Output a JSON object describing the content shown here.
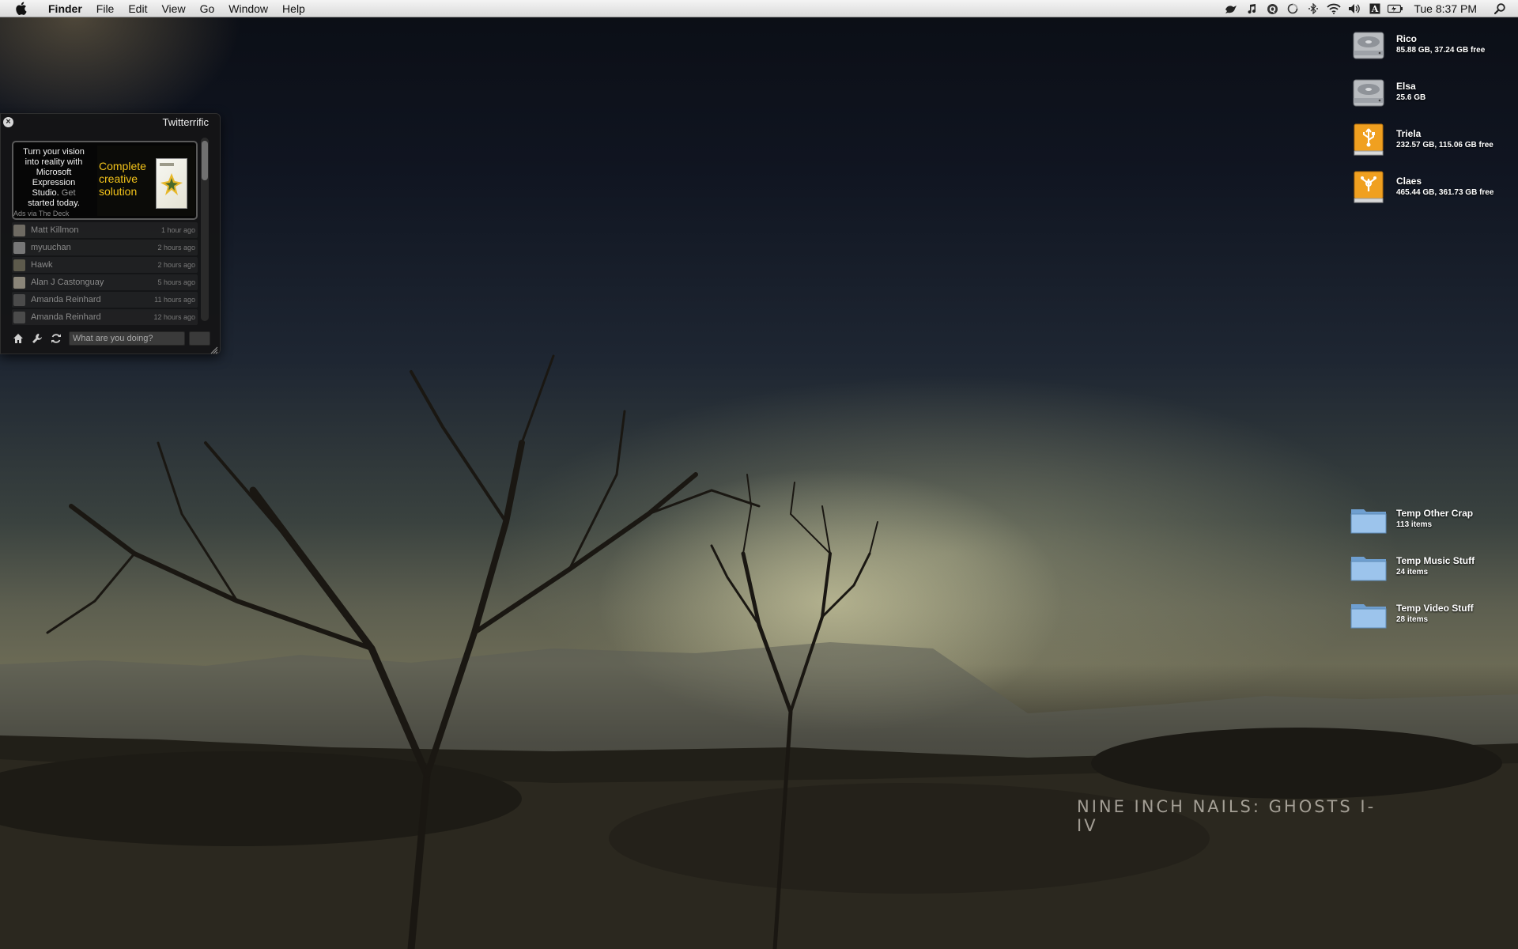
{
  "menubar": {
    "apple_icon": "apple-icon",
    "app_name": "Finder",
    "menus": [
      "File",
      "Edit",
      "View",
      "Go",
      "Window",
      "Help"
    ],
    "status_icons": [
      "twitterrific-bird-icon",
      "itunes-note-icon",
      "quicksilver-icon",
      "sync-icon",
      "bluetooth-icon",
      "wifi-icon",
      "volume-icon",
      "input-menu-icon",
      "battery-icon"
    ],
    "clock": "Tue 8:37 PM",
    "spotlight_icon": "spotlight-icon"
  },
  "desktop": {
    "drives": [
      {
        "name": "Rico",
        "info": "85.88 GB, 37.24 GB free",
        "icon": "hard-drive-icon"
      },
      {
        "name": "Elsa",
        "info": "25.6 GB",
        "icon": "hard-drive-icon"
      },
      {
        "name": "Triela",
        "info": "232.57 GB, 115.06 GB free",
        "icon": "usb-drive-icon"
      },
      {
        "name": "Claes",
        "info": "465.44 GB, 361.73 GB free",
        "icon": "firewire-drive-icon"
      }
    ],
    "folders": [
      {
        "name": "Temp Other Crap",
        "info": "113 items",
        "icon": "folder-icon"
      },
      {
        "name": "Temp Music Stuff",
        "info": "24 items",
        "icon": "folder-icon"
      },
      {
        "name": "Temp Video Stuff",
        "info": "28 items",
        "icon": "folder-icon"
      }
    ]
  },
  "wallpaper": {
    "text": "NINE INCH NAILS: GHOSTS I-IV"
  },
  "twitterrific": {
    "title": "Twitterrific",
    "ad": {
      "text": "Turn your vision into reality with Microsoft Expression Studio.",
      "link": "Get",
      "text2": "started today.",
      "headline": "Complete creative solution",
      "via": "Ads via The Deck"
    },
    "tweets": [
      {
        "name": "Matt Killmon",
        "time": "1 hour ago"
      },
      {
        "name": "myuuchan",
        "time": "2 hours ago"
      },
      {
        "name": "Hawk",
        "time": "2 hours ago"
      },
      {
        "name": "Alan J Castonguay",
        "time": "5 hours ago"
      },
      {
        "name": "Amanda Reinhard",
        "time": "11 hours ago"
      },
      {
        "name": "Amanda Reinhard",
        "time": "12 hours ago"
      }
    ],
    "input_placeholder": "What are you doing?",
    "colors": {
      "ad_headline": "#f3c31a"
    }
  }
}
